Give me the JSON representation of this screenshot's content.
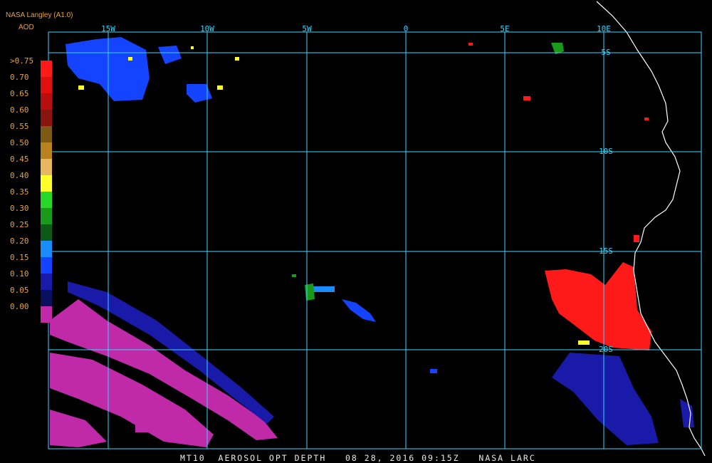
{
  "legend": {
    "title": "NASA Langley (A1.0)",
    "subtitle": "AOD",
    "entries": [
      {
        "label": ">0.75",
        "color": "#ff1a1a"
      },
      {
        "label": "0.70",
        "color": "#e01010"
      },
      {
        "label": "0.65",
        "color": "#b80e0e"
      },
      {
        "label": "0.60",
        "color": "#8a1410"
      },
      {
        "label": "0.55",
        "color": "#7a5a14"
      },
      {
        "label": "0.50",
        "color": "#b8821e"
      },
      {
        "label": "0.45",
        "color": "#e8b860"
      },
      {
        "label": "0.40",
        "color": "#ffff2a"
      },
      {
        "label": "0.35",
        "color": "#28d828"
      },
      {
        "label": "0.30",
        "color": "#1a9a1a"
      },
      {
        "label": "0.25",
        "color": "#0d5a18"
      },
      {
        "label": "0.20",
        "color": "#1a8cff"
      },
      {
        "label": "0.15",
        "color": "#1444ff"
      },
      {
        "label": "0.10",
        "color": "#1a1aa8"
      },
      {
        "label": "0.05",
        "color": "#0a1060"
      },
      {
        "label": "0.00",
        "color": "#c02aa8"
      }
    ]
  },
  "grid": {
    "longitudes": [
      "15W",
      "10W",
      "5W",
      "0",
      "5E",
      "10E"
    ],
    "latitudes": [
      "5S",
      "10S",
      "15S",
      "20S"
    ],
    "color": "#37d6ff"
  },
  "footer": "MT10  AEROSOL OPT DEPTH   08 28, 2016 09:15Z   NASA LARC"
}
